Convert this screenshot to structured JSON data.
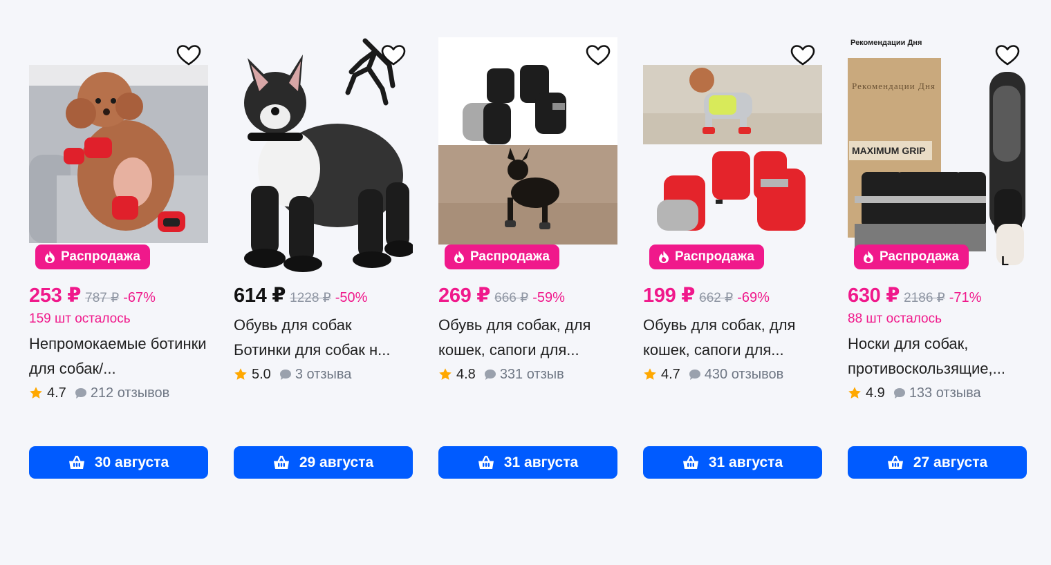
{
  "products": [
    {
      "sale_label": "Распродажа",
      "price": "253 ₽",
      "old_price": "787 ₽",
      "discount": "-67%",
      "stock": "159 шт осталось",
      "title": "Непромокаемые ботинки для собак/...",
      "rating": "4.7",
      "reviews": "212 отзывов",
      "delivery": "30 августа",
      "image_desc": "poodle-in-red-boots"
    },
    {
      "sale_label": "",
      "price": "614 ₽",
      "old_price": "1228 ₽",
      "discount": "-50%",
      "stock": "",
      "title": "Обувь для собак Ботинки для собак н...",
      "rating": "5.0",
      "reviews": "3 отзыва",
      "delivery": "29 августа",
      "image_desc": "bulldog-in-suspender-boots"
    },
    {
      "sale_label": "Распродажа",
      "price": "269 ₽",
      "old_price": "666 ₽",
      "discount": "-59%",
      "stock": "",
      "title": "Обувь для собак, для кошек, сапоги для...",
      "rating": "4.8",
      "reviews": "331 отзыв",
      "delivery": "31 августа",
      "image_desc": "black-boots-and-small-dog"
    },
    {
      "sale_label": "Распродажа",
      "price": "199 ₽",
      "old_price": "662 ₽",
      "discount": "-69%",
      "stock": "",
      "title": "Обувь для собак, для кошек, сапоги для...",
      "rating": "4.7",
      "reviews": "430 отзывов",
      "delivery": "31 августа",
      "image_desc": "red-boots-and-poodle"
    },
    {
      "sale_label": "Распродажа",
      "price": "630 ₽",
      "old_price": "2186 ₽",
      "discount": "-71%",
      "stock": "88 шт осталось",
      "title": "Носки для собак, противоскользящие,...",
      "rating": "4.9",
      "reviews": "133 отзыва",
      "delivery": "27 августа",
      "image_desc": "anti-slip-dog-socks",
      "brand_text": "Рекомендации Дня",
      "box_text_1": "Рекомендации Дня",
      "box_text_2": "MAXIMUM GRIP",
      "size_label": "L"
    }
  ],
  "colors": {
    "accent_pink": "#f0198b",
    "button_blue": "#005bff",
    "star": "#ffa800",
    "muted": "#8f96a3"
  },
  "icons": [
    "heart-icon",
    "fire-icon",
    "star-icon",
    "comment-icon",
    "basket-icon"
  ]
}
